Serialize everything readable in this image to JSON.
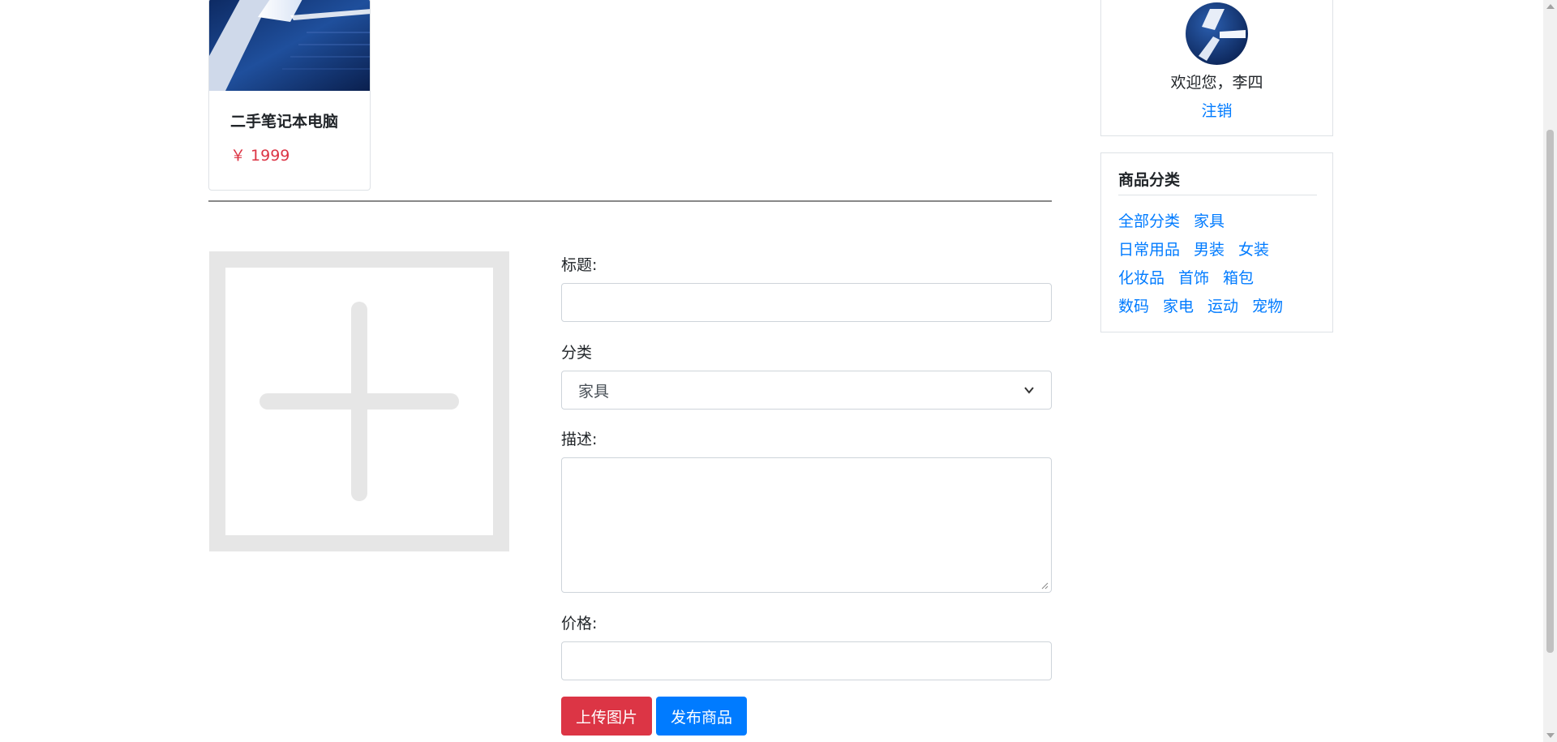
{
  "product": {
    "title": "二手笔记本电脑",
    "price": "￥ 1999"
  },
  "form": {
    "title_label": "标题:",
    "title_value": "",
    "category_label": "分类",
    "category_selected": "家具",
    "description_label": "描述:",
    "description_value": "",
    "price_label": "价格:",
    "price_value": "",
    "upload_button": "上传图片",
    "publish_button": "发布商品"
  },
  "user": {
    "welcome": "欢迎您，李四",
    "logout": "注销"
  },
  "categories": {
    "title": "商品分类",
    "items": [
      "全部分类",
      "家具",
      "日常用品",
      "男装",
      "女装",
      "化妆品",
      "首饰",
      "箱包",
      "数码",
      "家电",
      "运动",
      "宠物"
    ]
  },
  "colors": {
    "primary": "#007bff",
    "danger": "#dc3545",
    "placeholder_gray": "#e6e6e6",
    "border": "#dee2e6"
  },
  "icons": {
    "upload_placeholder": "plus-in-square-icon",
    "avatar": "user-avatar",
    "select_arrow": "chevron-down-icon"
  }
}
